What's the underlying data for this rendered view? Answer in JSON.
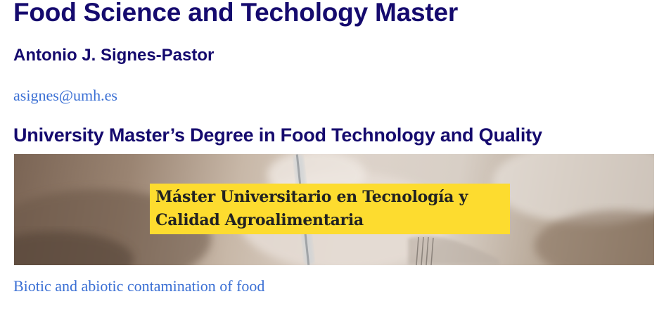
{
  "header": {
    "title": "Food Science and Techology Master",
    "author": "Antonio J. Signes-Pastor",
    "email": "asignes@umh.es"
  },
  "main": {
    "degree_heading": "University Master’s Degree in Food Technology and Quality",
    "banner": {
      "caption_line1": "Máster Universitario en Tecnología y",
      "caption_line2": "Calidad Agroalimentaria",
      "caption_background": "#fddc2f"
    },
    "course_link": "Biotic and abiotic contamination of food"
  },
  "colors": {
    "heading": "#150a6e",
    "link": "#3a6fd4"
  }
}
